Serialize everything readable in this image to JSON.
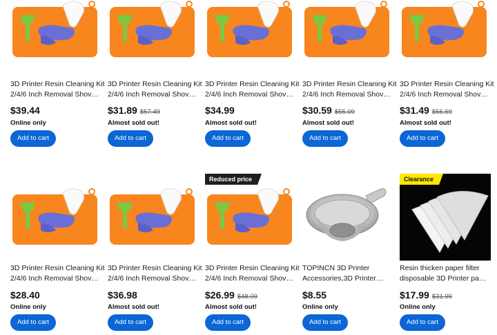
{
  "colors": {
    "accent": "#0b66d6",
    "badge_dark": "#1f1f1f",
    "badge_yellow": "#ffe600"
  },
  "products": [
    {
      "image": "resin-kit-image",
      "badge": "",
      "title1": "3D Printer Resin Cleaning Kit",
      "title2": "2/4/6 Inch Removal Shovel…",
      "price": "$39.44",
      "was": "",
      "stock": "Online only",
      "cta": "Add to cart"
    },
    {
      "image": "resin-kit-image",
      "badge": "",
      "title1": "3D Printer Resin Cleaning Kit",
      "title2": "2/4/6 Inch Removal Shovel…",
      "price": "$31.89",
      "was": "$57.49",
      "stock": "Almost sold out!",
      "cta": "Add to cart"
    },
    {
      "image": "resin-kit-image",
      "badge": "",
      "title1": "3D Printer Resin Cleaning Kit",
      "title2": "2/4/6 Inch Removal Shovel…",
      "price": "$34.99",
      "was": "",
      "stock": "Almost sold out!",
      "cta": "Add to cart"
    },
    {
      "image": "resin-kit-image",
      "badge": "",
      "title1": "3D Printer Resin Cleaning Kit",
      "title2": "2/4/6 Inch Removal Shovel…",
      "price": "$30.59",
      "was": "$55.09",
      "stock": "Almost sold out!",
      "cta": "Add to cart"
    },
    {
      "image": "resin-kit-image",
      "badge": "",
      "title1": "3D Printer Resin Cleaning Kit",
      "title2": "2/4/6 Inch Removal Shovel…",
      "price": "$31.49",
      "was": "$56.69",
      "stock": "Almost sold out!",
      "cta": "Add to cart"
    },
    {
      "image": "resin-kit-image",
      "badge": "",
      "title1": "3D Printer Resin Cleaning Kit",
      "title2": "2/4/6 Inch Removal Shovel…",
      "price": "$28.40",
      "was": "",
      "stock": "Online only",
      "cta": "Add to cart"
    },
    {
      "image": "resin-kit-image",
      "badge": "",
      "title1": "3D Printer Resin Cleaning Kit",
      "title2": "2/4/6 Inch Removal Shovel…",
      "price": "$36.98",
      "was": "",
      "stock": "Almost sold out!",
      "cta": "Add to cart"
    },
    {
      "image": "resin-kit-image",
      "badge": "Reduced price",
      "title1": "3D Printer Resin Cleaning Kit",
      "title2": "2/4/6 Inch Removal Shovel…",
      "price": "$26.99",
      "was": "$48.09",
      "stock": "Almost sold out!",
      "cta": "Add to cart"
    },
    {
      "image": "metal-strainer-image",
      "badge": "",
      "title1": "TOPINCN 3D Printer",
      "title2": "Accessories,3D Printer…",
      "price": "$8.55",
      "was": "",
      "stock": "Online only",
      "cta": "Add to cart"
    },
    {
      "image": "paper-filter-image",
      "badge": "Clearance",
      "title1": "Resin thicken paper filter",
      "title2": "disposable 3D Printer part…",
      "price": "$17.99",
      "was": "$31.99",
      "stock": "Online only",
      "cta": "Add to cart"
    }
  ]
}
